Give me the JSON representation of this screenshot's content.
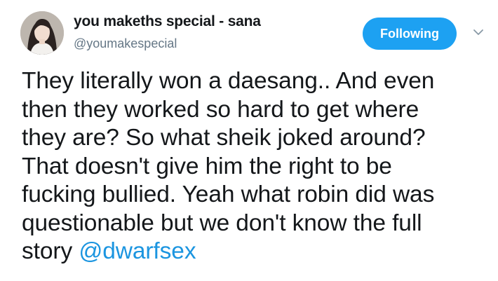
{
  "user": {
    "display_name": "you makeths special - sana",
    "handle": "@youmakespecial",
    "avatar_icon": "profile-photo"
  },
  "follow_button": {
    "label": "Following",
    "color": "#1da1f2"
  },
  "menu": {
    "icon": "chevron-down-icon"
  },
  "tweet": {
    "lines": [
      "They literally won a daesang.. And even",
      "then they worked so hard to get where",
      "they are? So what sheik joked around?",
      "That doesn't give him the right to be",
      "fucking bullied. Yeah what robin did was",
      "questionable but we don't know the full",
      "story "
    ],
    "mention": "@dwarfsex",
    "mention_color": "#1b95e0"
  }
}
